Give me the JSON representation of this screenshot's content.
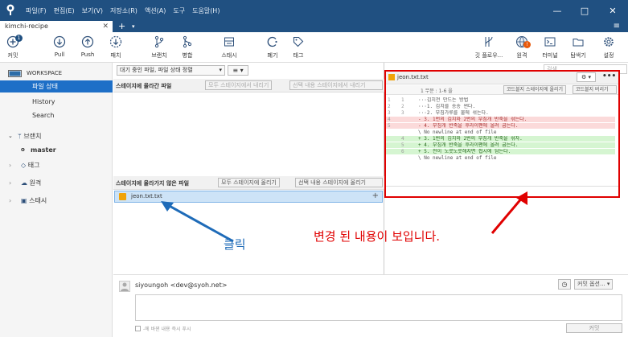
{
  "window": {
    "menus": [
      "파일(F)",
      "편집(E)",
      "보기(V)",
      "저장소(R)",
      "액션(A)",
      "도구",
      "도움말(H)"
    ],
    "minimize": "—",
    "maximize": "□",
    "close": "✕"
  },
  "tabs": {
    "active": "kimchi-recipe",
    "close": "✕",
    "add": "+",
    "dropdown": "▾",
    "menu": "≡"
  },
  "toolbar": {
    "commit": "커밋",
    "commit_badge": "1",
    "pull": "Pull",
    "push": "Push",
    "fetch": "패치",
    "branch": "브랜치",
    "merge": "병합",
    "stash": "스태시",
    "discard": "폐기",
    "tag": "태그",
    "git_flow": "깃 플로우...",
    "remote": "원격",
    "terminal": "터미널",
    "explorer": "탐색기",
    "settings": "설정",
    "search_placeholder": "검색",
    "accent": "#205081",
    "badge_color": "#e8590c"
  },
  "sidebar": {
    "workspace": "WORKSPACE",
    "items": [
      "파일 상태",
      "History",
      "Search"
    ],
    "branches": "브랜치",
    "current_branch": "master",
    "tags": "태그",
    "remotes": "원격",
    "stashes": "스태시"
  },
  "center": {
    "filter": "대기 중인 파일, 파일 상태 정렬",
    "staged_title": "스테이지에 올라간 파일",
    "unstage_all": "모두 스테이지에서 내리기",
    "unstage_selected": "선택 내용 스테이지에서 내리기",
    "unstaged_title": "스테이지에 올라가지 않은 파일",
    "stage_all": "모두 스테이지에 올리기",
    "stage_selected": "선택 내용 스테이지에 올리기",
    "file": "jeon.txt.txt",
    "add": "+"
  },
  "diff": {
    "file": "jeon.txt.txt",
    "hunk": "1 무문 : 1-6 을",
    "stage_hunk": "코드블지 스테이지에 올리기",
    "discard_hunk": "코드블지 버리기",
    "lines": [
      {
        "o": "1",
        "n": "1",
        "t": "ctx",
        "text": "···김치전 만드는 방법"
      },
      {
        "o": "2",
        "n": "2",
        "t": "ctx",
        "text": "···1. 김치를 송송 썬다."
      },
      {
        "o": "3",
        "n": "3",
        "t": "ctx",
        "text": "···2. 부침가루를 물에 섞는다."
      },
      {
        "o": "4",
        "n": "",
        "t": "del",
        "text": "- 3. 1번의 김치와 2번의 부침개 반죽을 섞는다."
      },
      {
        "o": "5",
        "n": "",
        "t": "del",
        "text": "- 4. 부침개 반죽을 후라이팬에 올려 굽는다."
      },
      {
        "o": "",
        "n": "",
        "t": "ctx",
        "text": "\\  No newline at end of file"
      },
      {
        "o": "",
        "n": "4",
        "t": "add",
        "text": "+ 3. 1번의 김치와 2번의 부침개 반죽을 섞자."
      },
      {
        "o": "",
        "n": "5",
        "t": "add",
        "text": "+ 4. 부침개 반죽을 후라이팬에 올려 굽는다."
      },
      {
        "o": "",
        "n": "6",
        "t": "add",
        "text": "+ 5. 전이 노릇노릇해지면 접시에 담는다."
      },
      {
        "o": "",
        "n": "",
        "t": "ctx",
        "text": "\\  No newline at end of file"
      }
    ]
  },
  "commit": {
    "author": "siyoungoh <dev@syoh.net>",
    "options": "커밋 옵션...",
    "push_immediately": "-에 바뀐 내용 즉시 푸시",
    "commit_button": "커밋"
  },
  "annotations": {
    "click": "클릭",
    "changes_shown": "변경 된 내용이 보입니다.",
    "color": "#e00000",
    "arrow_color": "#1e6bb8"
  }
}
